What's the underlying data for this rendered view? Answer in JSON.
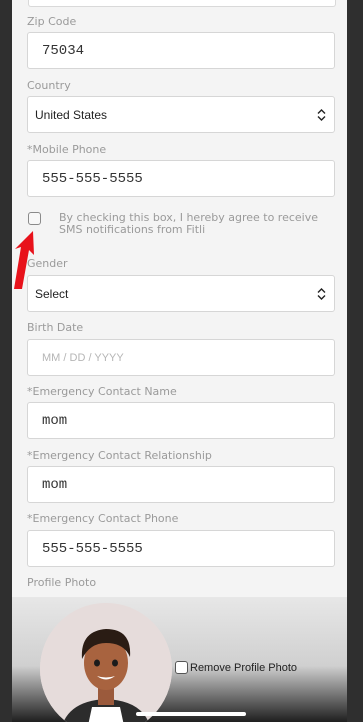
{
  "form": {
    "zip": {
      "label": "Zip Code",
      "value": "75034"
    },
    "country": {
      "label": "Country",
      "value": "United States"
    },
    "mobile_phone": {
      "label": "*Mobile Phone",
      "value": "555-555-5555"
    },
    "sms_consent": {
      "text": "By checking this box, I hereby agree to receive SMS notifications from Fitli",
      "checked": false
    },
    "gender": {
      "label": "Gender",
      "value": "Select"
    },
    "birth_date": {
      "label": "Birth Date",
      "placeholder": "MM / DD / YYYY"
    },
    "emergency_name": {
      "label": "*Emergency Contact Name",
      "value": "mom"
    },
    "emergency_relationship": {
      "label": "*Emergency Contact Relationship",
      "value": "mom"
    },
    "emergency_phone": {
      "label": "*Emergency Contact Phone",
      "value": "555-555-5555"
    },
    "profile_photo": {
      "label": "Profile Photo",
      "remove_label": "Remove Profile Photo",
      "remove_checked": false
    }
  },
  "icons": {
    "select_arrows": "up-down-chevron-icon",
    "annotation": "red-arrow-icon",
    "avatar": "profile-avatar-illustration"
  },
  "colors": {
    "arrow": "#e8121b",
    "background": "#f4f4f4",
    "frame": "#2f2f2f"
  }
}
